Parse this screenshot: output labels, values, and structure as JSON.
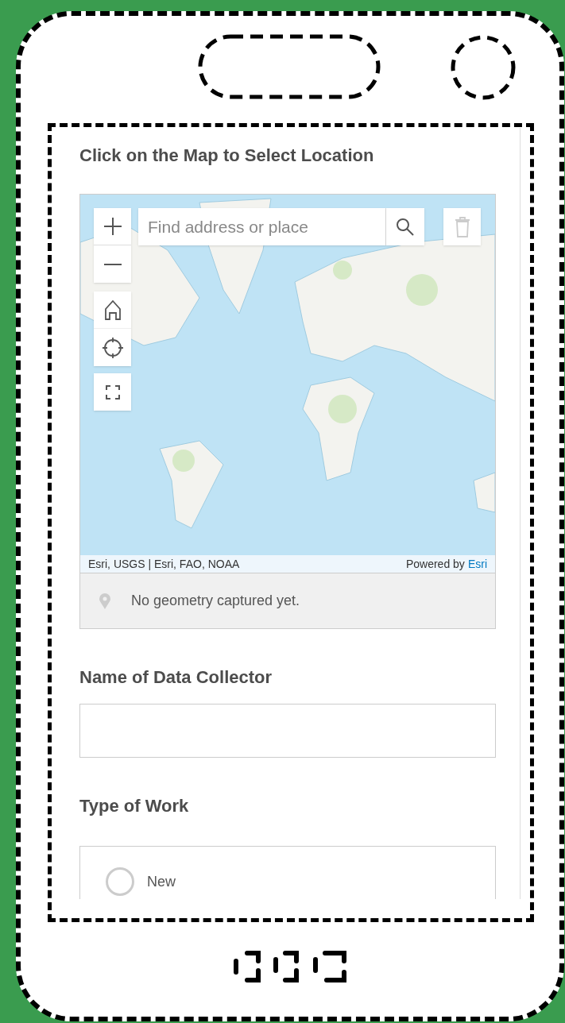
{
  "form": {
    "map_question": {
      "label": "Click on the Map to Select Location",
      "search": {
        "placeholder": "Find address or place"
      },
      "attribution": "Esri, USGS | Esri, FAO, NOAA",
      "powered_by": "Powered by",
      "powered_link": "Esri",
      "status": "No geometry captured yet."
    },
    "fields": [
      {
        "kind": "text",
        "label": "Name of Data Collector"
      },
      {
        "kind": "radio",
        "label": "Type of Work",
        "options": [
          {
            "label": "New",
            "selected": false
          }
        ]
      }
    ]
  }
}
